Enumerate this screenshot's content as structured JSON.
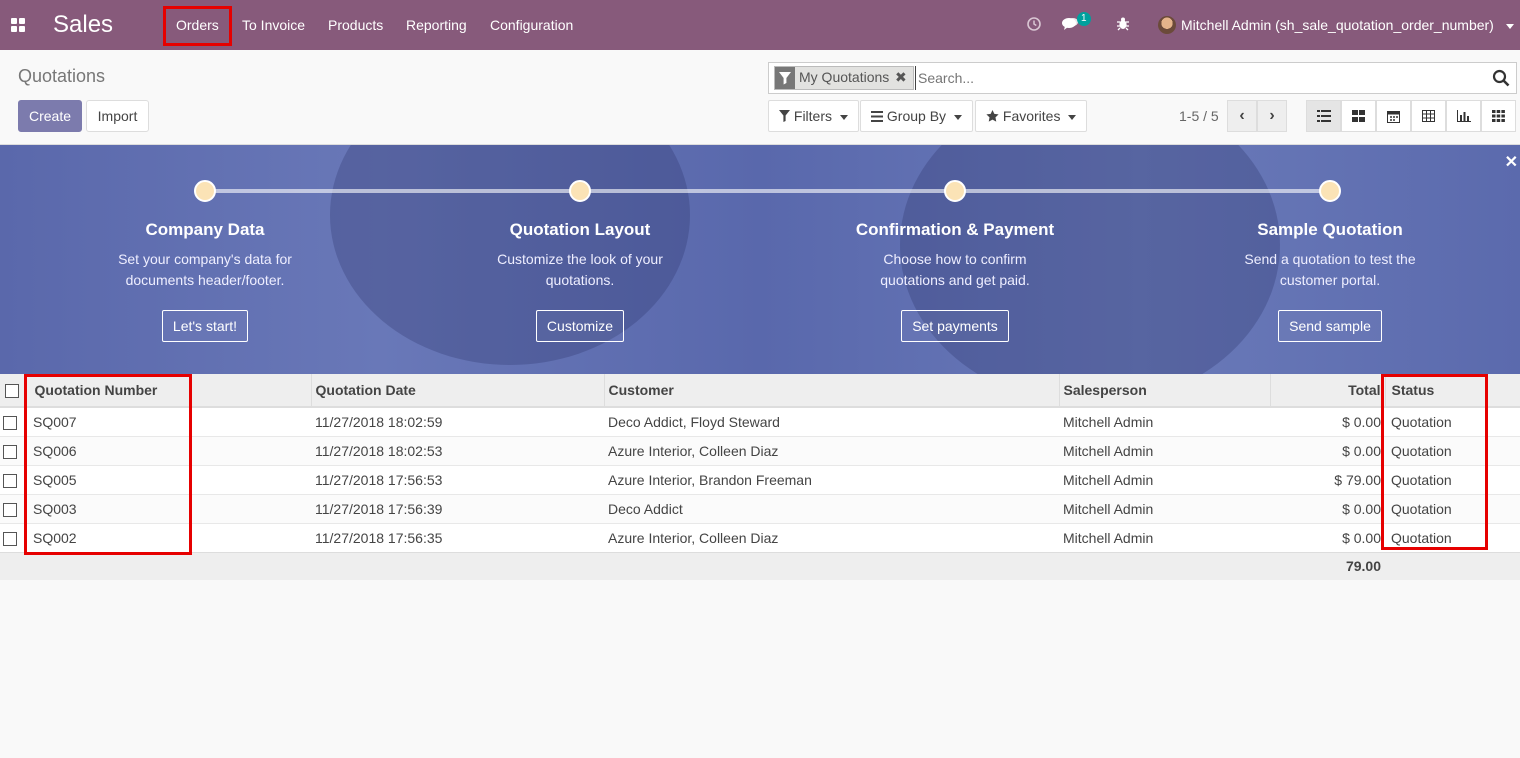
{
  "navbar": {
    "brand": "Sales",
    "menu": [
      "Orders",
      "To Invoice",
      "Products",
      "Reporting",
      "Configuration"
    ],
    "messages_badge": "1",
    "user": "Mitchell Admin (sh_sale_quotation_order_number)",
    "bg_color": "#875a7b"
  },
  "control_panel": {
    "breadcrumb": "Quotations",
    "create_label": "Create",
    "import_label": "Import",
    "search": {
      "facet": "My Quotations",
      "placeholder": "Search..."
    },
    "filters_label": "Filters",
    "group_by_label": "Group By",
    "favorites_label": "Favorites",
    "pager": "1-5 / 5"
  },
  "banner": {
    "steps": [
      {
        "title": "Company Data",
        "desc": "Set your company's data for documents header/footer.",
        "button": "Let's start!"
      },
      {
        "title": "Quotation Layout",
        "desc": "Customize the look of your quotations.",
        "button": "Customize"
      },
      {
        "title": "Confirmation & Payment",
        "desc": "Choose how to confirm quotations and get paid.",
        "button": "Set payments"
      },
      {
        "title": "Sample Quotation",
        "desc": "Send a quotation to test the customer portal.",
        "button": "Send sample"
      }
    ]
  },
  "table": {
    "columns": [
      "Quotation Number",
      "Quotation Date",
      "Customer",
      "Salesperson",
      "Total",
      "Status"
    ],
    "rows": [
      {
        "number": "SQ007",
        "date": "11/27/2018 18:02:59",
        "customer": "Deco Addict, Floyd Steward",
        "salesperson": "Mitchell Admin",
        "total": "$ 0.00",
        "status": "Quotation"
      },
      {
        "number": "SQ006",
        "date": "11/27/2018 18:02:53",
        "customer": "Azure Interior, Colleen Diaz",
        "salesperson": "Mitchell Admin",
        "total": "$ 0.00",
        "status": "Quotation"
      },
      {
        "number": "SQ005",
        "date": "11/27/2018 17:56:53",
        "customer": "Azure Interior, Brandon Freeman",
        "salesperson": "Mitchell Admin",
        "total": "$ 79.00",
        "status": "Quotation"
      },
      {
        "number": "SQ003",
        "date": "11/27/2018 17:56:39",
        "customer": "Deco Addict",
        "salesperson": "Mitchell Admin",
        "total": "$ 0.00",
        "status": "Quotation"
      },
      {
        "number": "SQ002",
        "date": "11/27/2018 17:56:35",
        "customer": "Azure Interior, Colleen Diaz",
        "salesperson": "Mitchell Admin",
        "total": "$ 0.00",
        "status": "Quotation"
      }
    ],
    "footer_total": "79.00"
  }
}
